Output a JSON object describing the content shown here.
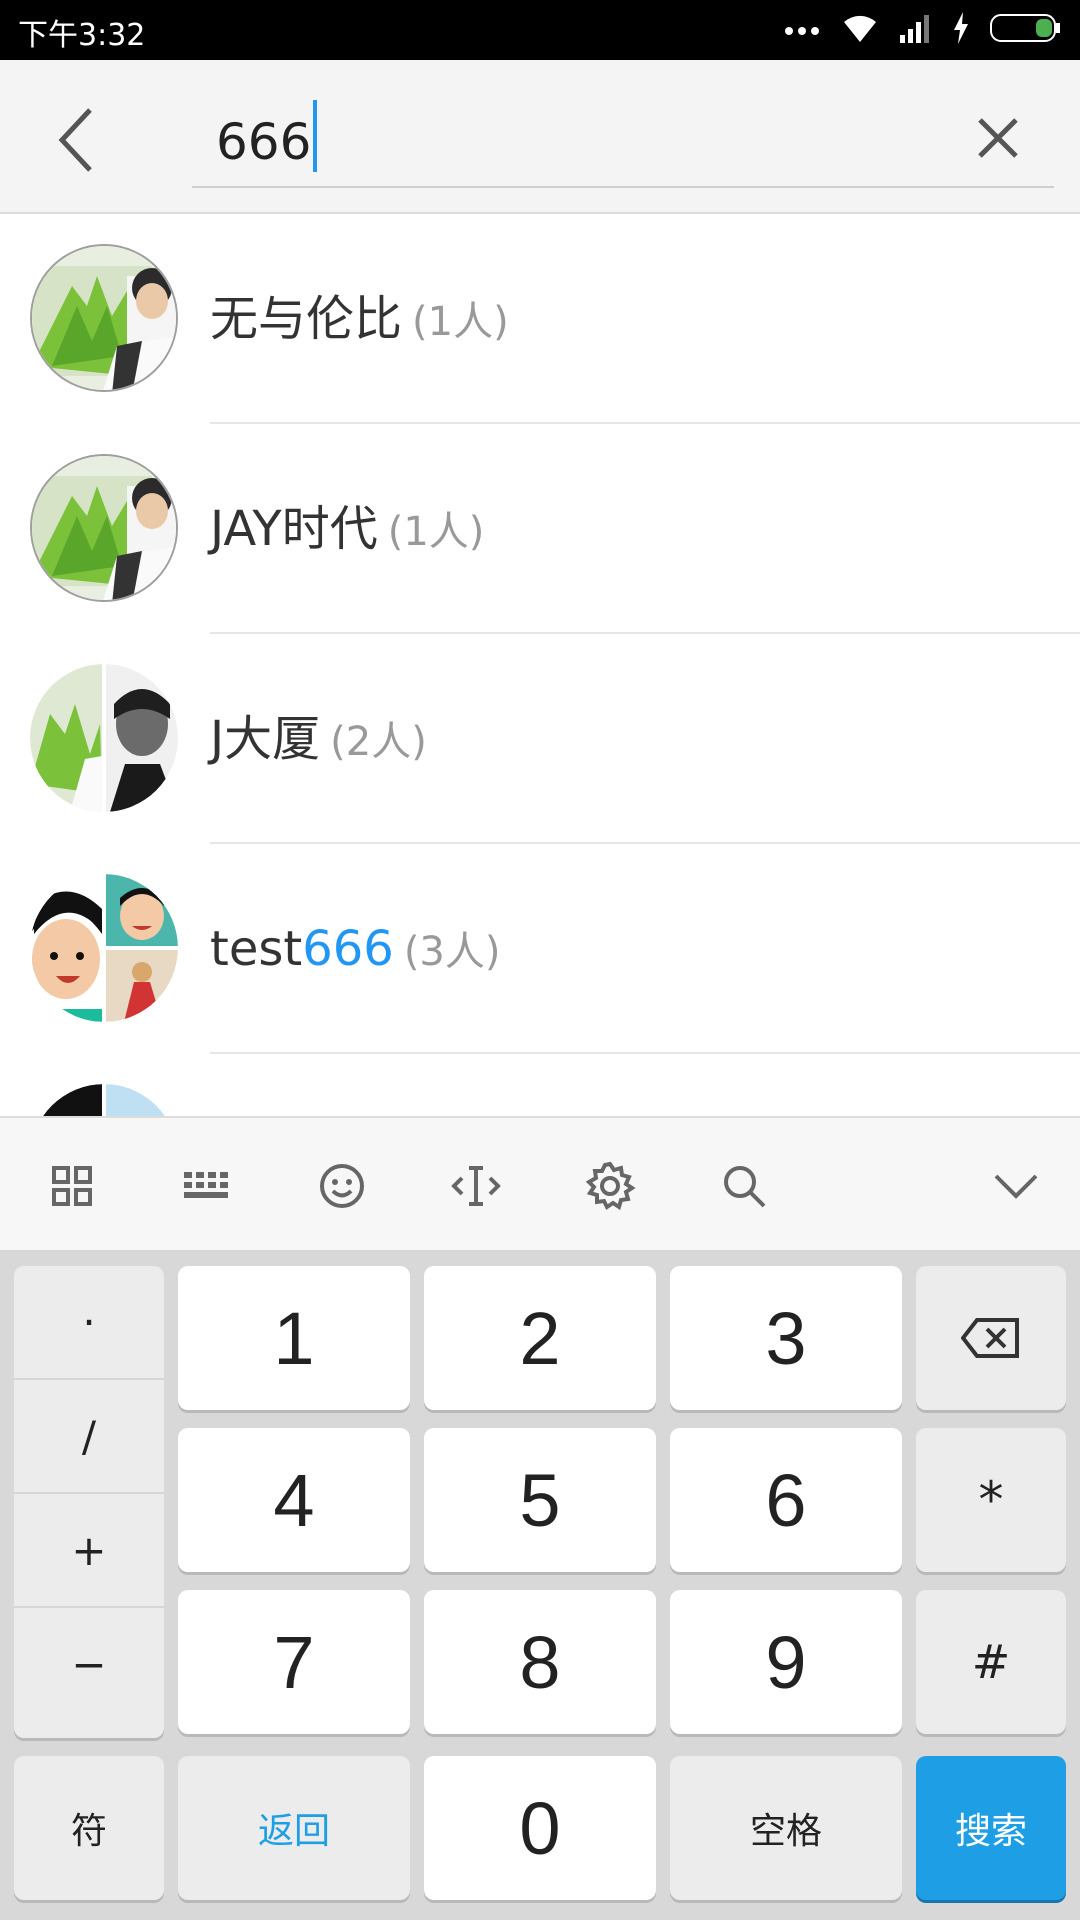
{
  "status_bar": {
    "time": "下午3:32"
  },
  "search": {
    "query": "666"
  },
  "results": [
    {
      "name": "无与伦比",
      "name_highlight": "",
      "count": "(1人)"
    },
    {
      "name": "JAY时代",
      "name_highlight": "",
      "count": "(1人)"
    },
    {
      "name": "J大厦",
      "name_highlight": "",
      "count": "(2人)"
    },
    {
      "name": "test",
      "name_highlight": "666",
      "count": "(3人)"
    }
  ],
  "keyboard": {
    "toolbar_icons": [
      "grid-icon",
      "keyboard-icon",
      "emoji-icon",
      "cursor-icon",
      "gear-icon",
      "search-icon",
      "chevron-down-icon"
    ],
    "symbols": [
      "·",
      "/",
      "+",
      "−"
    ],
    "digits": [
      "1",
      "2",
      "3",
      "4",
      "5",
      "6",
      "7",
      "8",
      "9",
      "0"
    ],
    "star": "*",
    "hash": "#",
    "fu": "符",
    "back": "返回",
    "space": "空格",
    "search": "搜索"
  },
  "colors": {
    "accent": "#2196f3",
    "search_key": "#1e9fe5"
  }
}
